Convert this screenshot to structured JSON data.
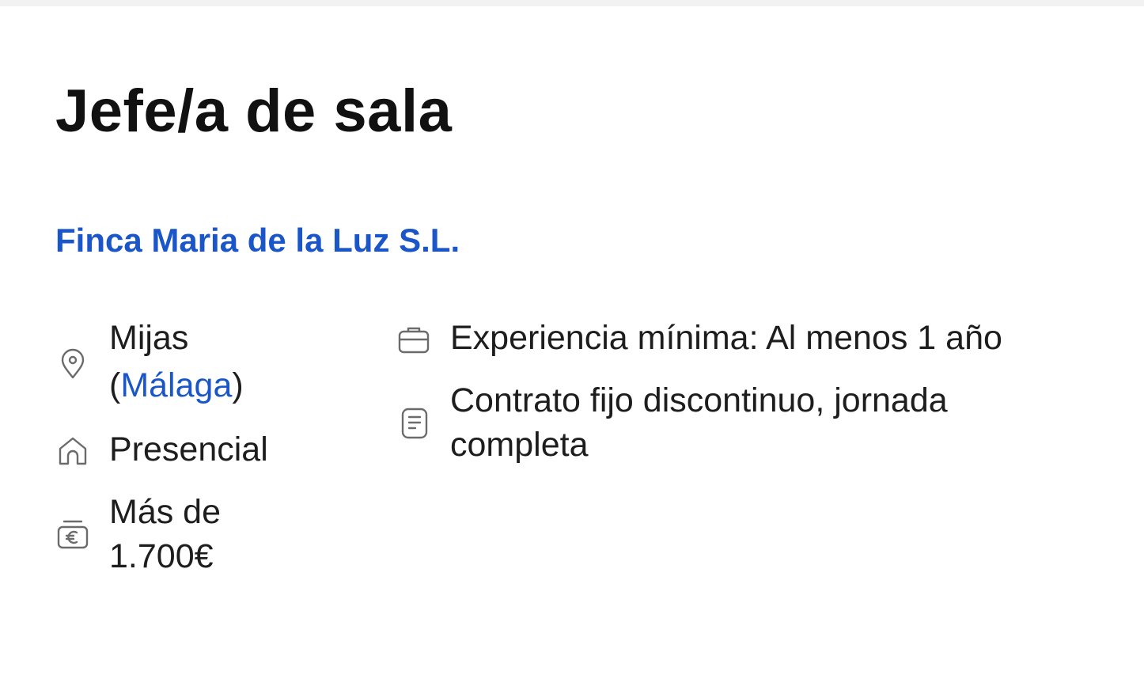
{
  "job": {
    "title": "Jefe/a de sala",
    "company": "Finca Maria de la Luz S.L."
  },
  "details_left": {
    "location_city": "Mijas",
    "location_paren_open": "(",
    "location_province": "Málaga",
    "location_paren_close": ")",
    "work_mode": "Presencial",
    "salary_line1": "Más de",
    "salary_line2": "1.700€"
  },
  "details_right": {
    "experience": "Experiencia mínima: Al menos 1 año",
    "contract_line1": "Contrato fijo discontinuo, jornada",
    "contract_line2": "completa"
  },
  "icons": {
    "location": "map-pin-icon",
    "work_mode": "home-icon",
    "salary": "euro-wallet-icon",
    "experience": "briefcase-icon",
    "contract": "document-icon"
  },
  "colors": {
    "accent": "#1a56c8",
    "text": "#1d1d1d",
    "title": "#111111",
    "icon": "#6b6b6b"
  }
}
